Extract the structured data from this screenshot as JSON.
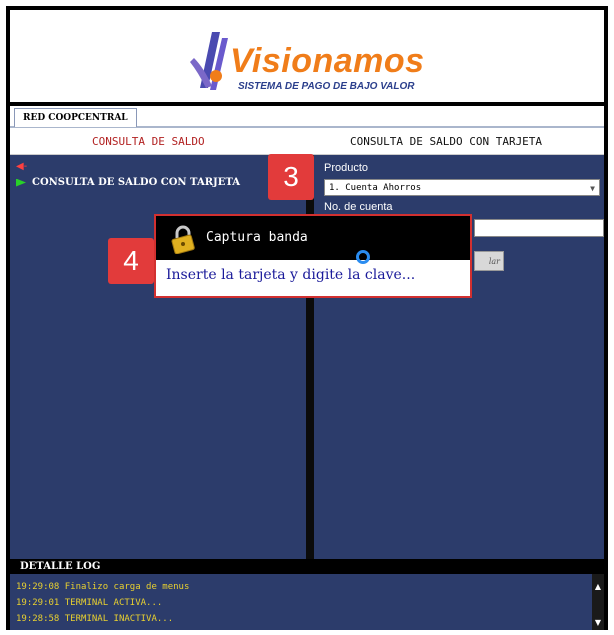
{
  "brand": {
    "name": "Visionamos",
    "tagline": "SISTEMA DE PAGO DE BAJO VALOR",
    "colors": {
      "wordmark": "#f07d1a",
      "tagline": "#2b3f8c",
      "panel": "#2c3c6b"
    }
  },
  "tabs": [
    {
      "label": "RED COOPCENTRAL"
    }
  ],
  "titles": {
    "left": "CONSULTA DE SALDO",
    "right": "CONSULTA DE SALDO CON TARJETA"
  },
  "tree": {
    "collapse_marker": "-",
    "items": [
      {
        "label": "CONSULTA DE SALDO CON TARJETA"
      }
    ]
  },
  "form": {
    "producto_label": "Producto",
    "producto_value": "1. Cuenta Ahorros",
    "cuenta_label": "No. de cuenta",
    "cuenta_value": "",
    "button_partial": "lar"
  },
  "popup": {
    "title": "Captura banda",
    "message": "Inserte la tarjeta y digite la clave...",
    "icon": "lock-icon"
  },
  "badges": {
    "step3": "3",
    "step4": "4"
  },
  "log": {
    "title": "DETALLE LOG",
    "entries": [
      "19:29:08 Finalizo carga de menus",
      "19:29:01 TERMINAL ACTIVA...",
      "19:28:58 TERMINAL INACTIVA..."
    ]
  }
}
